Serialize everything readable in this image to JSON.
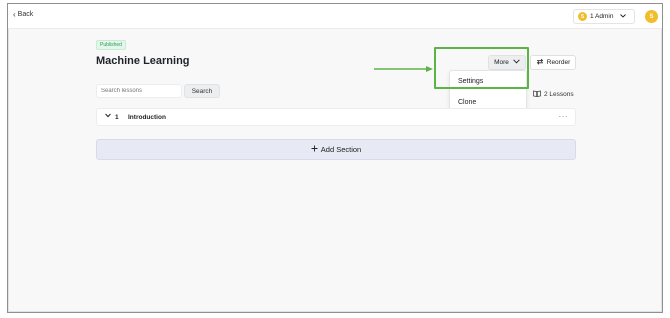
{
  "topbar": {
    "back_label": "Back",
    "org_initial": "S",
    "org_label": "1 Admin",
    "user_initial": "S"
  },
  "course": {
    "status_badge": "Published",
    "title": "Machine Learning"
  },
  "toolbar": {
    "more_label": "More",
    "reorder_label": "Reorder"
  },
  "more_menu": {
    "items": [
      {
        "label": "Settings"
      },
      {
        "label": "Clone"
      }
    ]
  },
  "search": {
    "placeholder": "Search lessons",
    "button_label": "Search"
  },
  "lessons_count_label": "2 Lessons",
  "sections": [
    {
      "number": "1",
      "name": "Introduction",
      "menu_icon": "more-horizontal-icon"
    }
  ],
  "add_section_label": "Add Section",
  "colors": {
    "accent_yellow": "#f2bd2a",
    "published_green": "#2f9a5c",
    "highlight_green": "#5cb446",
    "add_section_bg": "#e7eaf5"
  }
}
